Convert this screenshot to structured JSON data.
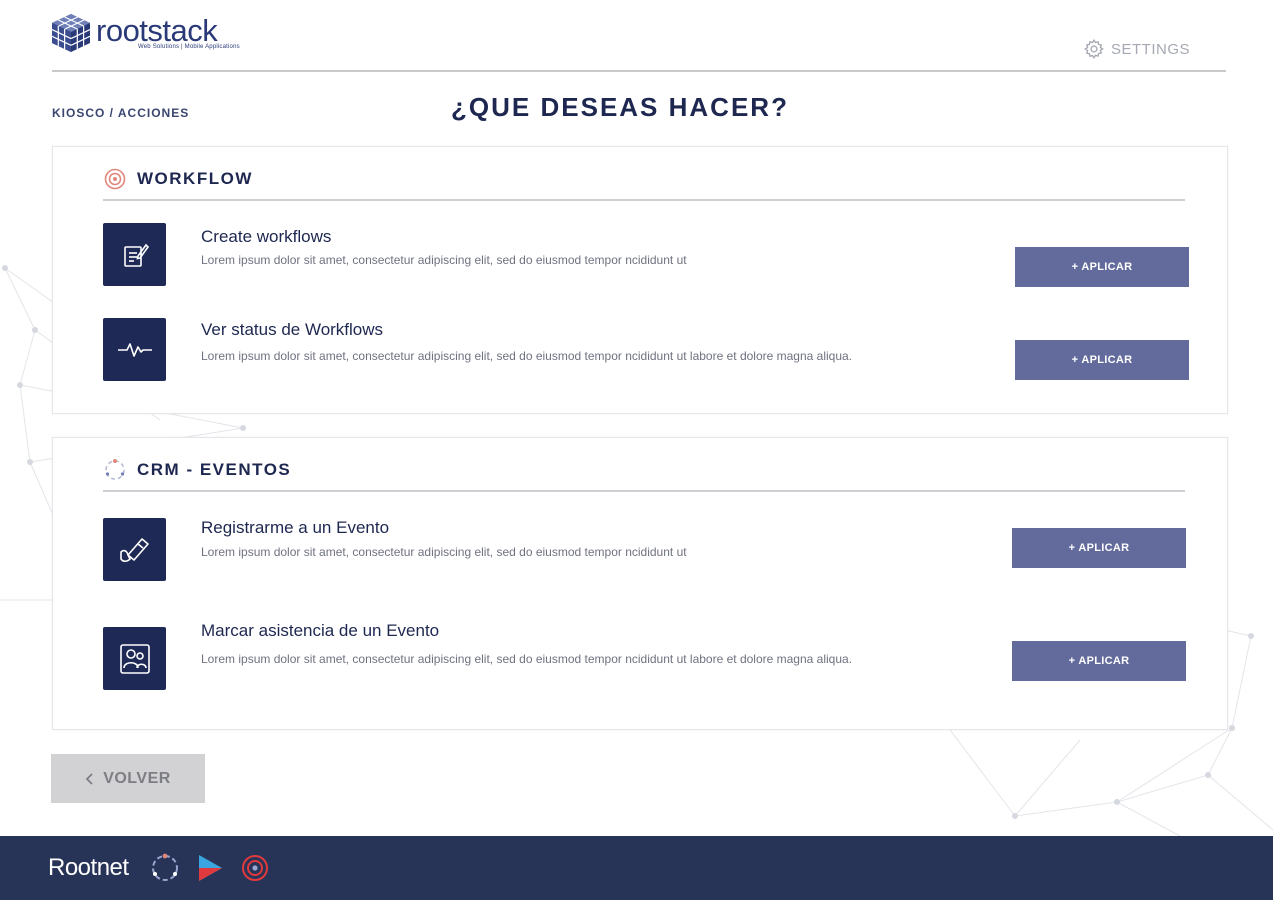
{
  "header": {
    "logo_text": "rootstack",
    "logo_tagline": "Web Solutions | Mobile Applications",
    "settings_label": "SETTINGS"
  },
  "breadcrumb": "KIOSCO / ACCIONES",
  "page_title": "¿QUE DESEAS HACER?",
  "sections": [
    {
      "title": "WORKFLOW",
      "items": [
        {
          "title": "Create workflows",
          "description": "Lorem ipsum dolor sit amet, consectetur adipiscing elit, sed do eiusmod tempor ncididunt ut",
          "button_label": "+ APLICAR"
        },
        {
          "title": "Ver status de Workflows",
          "description": "Lorem ipsum dolor sit amet, consectetur adipiscing elit, sed do eiusmod tempor ncididunt ut labore et dolore magna aliqua.",
          "button_label": "+ APLICAR"
        }
      ]
    },
    {
      "title": "CRM - EVENTOS",
      "items": [
        {
          "title": "Registrarme a un Evento",
          "description": "Lorem ipsum dolor sit amet, consectetur adipiscing elit, sed do eiusmod tempor ncididunt ut",
          "button_label": "+ APLICAR"
        },
        {
          "title": "Marcar asistencia de un Evento",
          "description": "Lorem ipsum dolor sit amet, consectetur adipiscing elit, sed do eiusmod tempor ncididunt ut labore et dolore magna aliqua.",
          "button_label": "+ APLICAR"
        }
      ]
    }
  ],
  "back_button_label": "VOLVER",
  "footer": {
    "brand": "Rootnet",
    "icons": [
      "orbit-icon",
      "play-icon",
      "target-icon"
    ]
  },
  "colors": {
    "navy": "#1d2750",
    "button": "#636b9c",
    "footer": "#283457",
    "back_button": "#d2d2d4"
  }
}
